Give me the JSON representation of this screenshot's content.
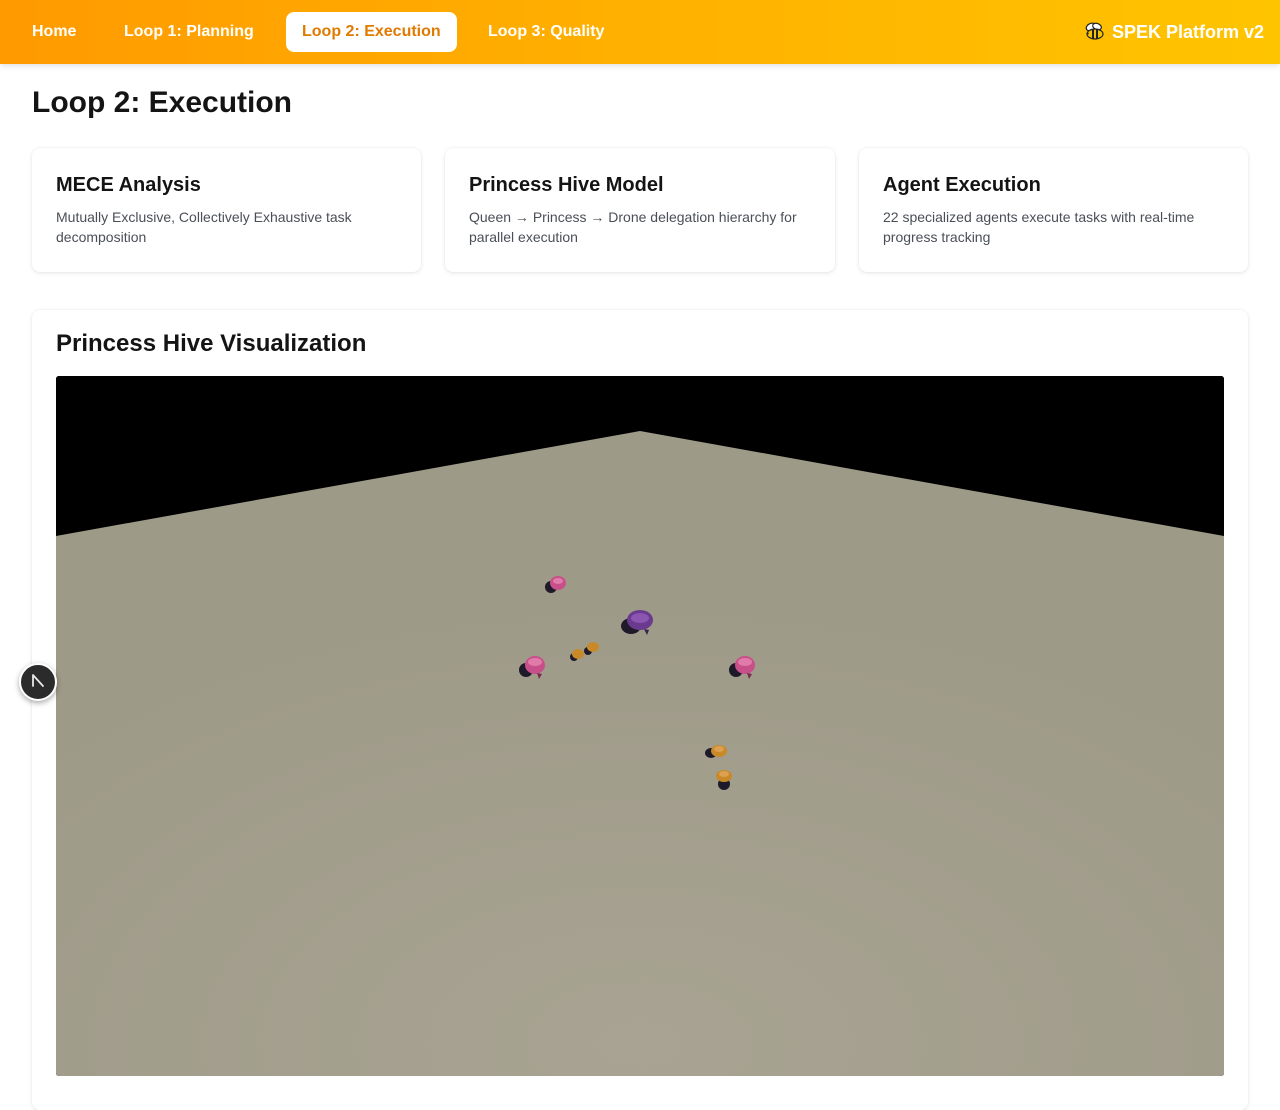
{
  "nav": {
    "home": "Home",
    "loop1": "Loop 1: Planning",
    "loop2": "Loop 2: Execution",
    "loop3": "Loop 3: Quality",
    "active": "loop2"
  },
  "brand": {
    "label": "SPEK Platform v2",
    "icon": "bee-icon"
  },
  "page": {
    "title": "Loop 2: Execution"
  },
  "cards": [
    {
      "title": "MECE Analysis",
      "description": "Mutually Exclusive, Collectively Exhaustive task decomposition"
    },
    {
      "title": "Princess Hive Model",
      "description": "Queen → Princess → Drone delegation hierarchy for parallel execution"
    },
    {
      "title": "Agent Execution",
      "description": "22 specialized agents execute tasks with real-time progress tracking"
    }
  ],
  "visualization": {
    "title": "Princess Hive Visualization",
    "colors": {
      "background": "#000000",
      "floor": "#a09c8a",
      "queen": "#6a3a8e",
      "princess": "#c8508a",
      "drone": "#c88a28"
    }
  },
  "floating_button": {
    "icon": "nextjs-logo-icon"
  },
  "colors": {
    "accent": "#ff9a00",
    "accent_end": "#ffc400",
    "active_text": "#e07a00"
  }
}
